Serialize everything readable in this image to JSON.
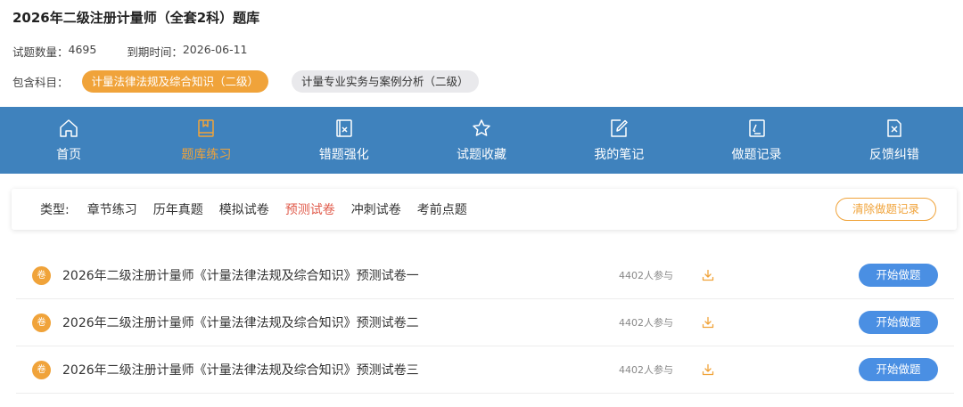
{
  "header": {
    "title": "2026年二级注册计量师（全套2科）题库",
    "question_count_label": "试题数量：",
    "question_count": "4695",
    "expiry_label": "到期时间：",
    "expiry_date": "2026-06-11",
    "subjects_label": "包含科目：",
    "subjects": [
      {
        "label": "计量法律法规及综合知识（二级）",
        "active": true
      },
      {
        "label": "计量专业实务与案例分析（二级）",
        "active": false
      }
    ]
  },
  "nav": {
    "items": [
      {
        "label": "首页",
        "icon": "home-icon",
        "active": false
      },
      {
        "label": "题库练习",
        "icon": "book-icon",
        "active": true
      },
      {
        "label": "错题强化",
        "icon": "wrong-doc-icon",
        "active": false
      },
      {
        "label": "试题收藏",
        "icon": "star-icon",
        "active": false
      },
      {
        "label": "我的笔记",
        "icon": "note-edit-icon",
        "active": false
      },
      {
        "label": "做题记录",
        "icon": "record-icon",
        "active": false
      },
      {
        "label": "反馈纠错",
        "icon": "feedback-icon",
        "active": false
      }
    ]
  },
  "filter": {
    "type_label": "类型:",
    "options": [
      {
        "label": "章节练习",
        "active": false
      },
      {
        "label": "历年真题",
        "active": false
      },
      {
        "label": "模拟试卷",
        "active": false
      },
      {
        "label": "预测试卷",
        "active": true
      },
      {
        "label": "冲刺试卷",
        "active": false
      },
      {
        "label": "考前点题",
        "active": false
      }
    ],
    "clear_label": "清除做题记录"
  },
  "papers": [
    {
      "badge": "卷",
      "name": "2026年二级注册计量师《计量法律法规及综合知识》预测试卷一",
      "participants": "4402人参与",
      "start_label": "开始做题"
    },
    {
      "badge": "卷",
      "name": "2026年二级注册计量师《计量法律法规及综合知识》预测试卷二",
      "participants": "4402人参与",
      "start_label": "开始做题"
    },
    {
      "badge": "卷",
      "name": "2026年二级注册计量师《计量法律法规及综合知识》预测试卷三",
      "participants": "4402人参与",
      "start_label": "开始做题"
    }
  ],
  "colors": {
    "accent_orange": "#f0a33a",
    "nav_blue": "#3f82bd",
    "button_blue": "#4a8fe3",
    "active_red": "#e05a4a"
  }
}
